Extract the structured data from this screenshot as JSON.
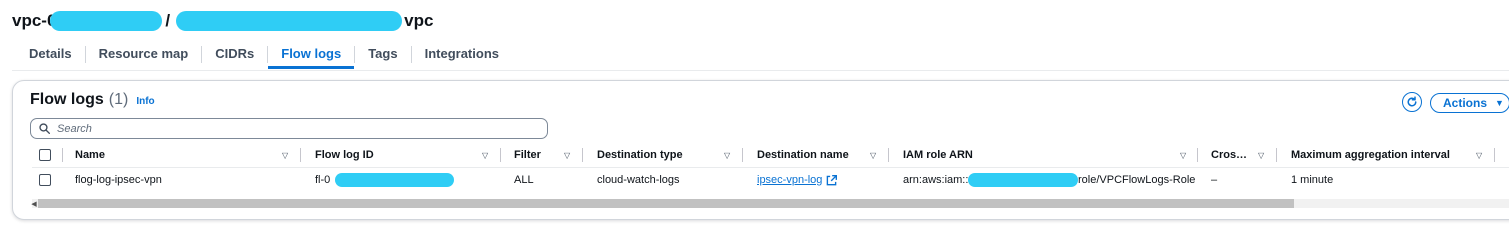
{
  "header": {
    "title_start": "vpc-0",
    "title_sep": "/",
    "title_end": "vpc"
  },
  "tabs": [
    {
      "label": "Details"
    },
    {
      "label": "Resource map"
    },
    {
      "label": "CIDRs"
    },
    {
      "label": "Flow logs",
      "active": true
    },
    {
      "label": "Tags"
    },
    {
      "label": "Integrations"
    }
  ],
  "panel": {
    "title": "Flow logs",
    "count": "(1)",
    "info": "Info",
    "actions_label": "Actions"
  },
  "search": {
    "placeholder": "Search"
  },
  "table": {
    "columns": [
      "Name",
      "Flow log ID",
      "Filter",
      "Destination type",
      "Destination name",
      "IAM role ARN",
      "Cros…",
      "Maximum aggregation interval"
    ],
    "rows": [
      {
        "name": "flog-log-ipsec-vpn",
        "flow_log_id": "fl-0",
        "filter": "ALL",
        "destination_type": "cloud-watch-logs",
        "destination_name": "ipsec-vpn-log",
        "iam_role_arn_start": "arn:aws:iam::",
        "iam_role_arn_end": "role/VPCFlowLogs-Role",
        "cross": "–",
        "max_aggregation_interval": "1 minute"
      }
    ]
  },
  "colors": {
    "accent": "#0972d3",
    "redaction": "#2fcdf5",
    "text": "#0f141a"
  },
  "icons": {
    "refresh": "refresh-icon",
    "search": "search-icon",
    "sort": "sort-caret-icon",
    "external": "external-link-icon",
    "dropdown": "caret-down-icon"
  }
}
